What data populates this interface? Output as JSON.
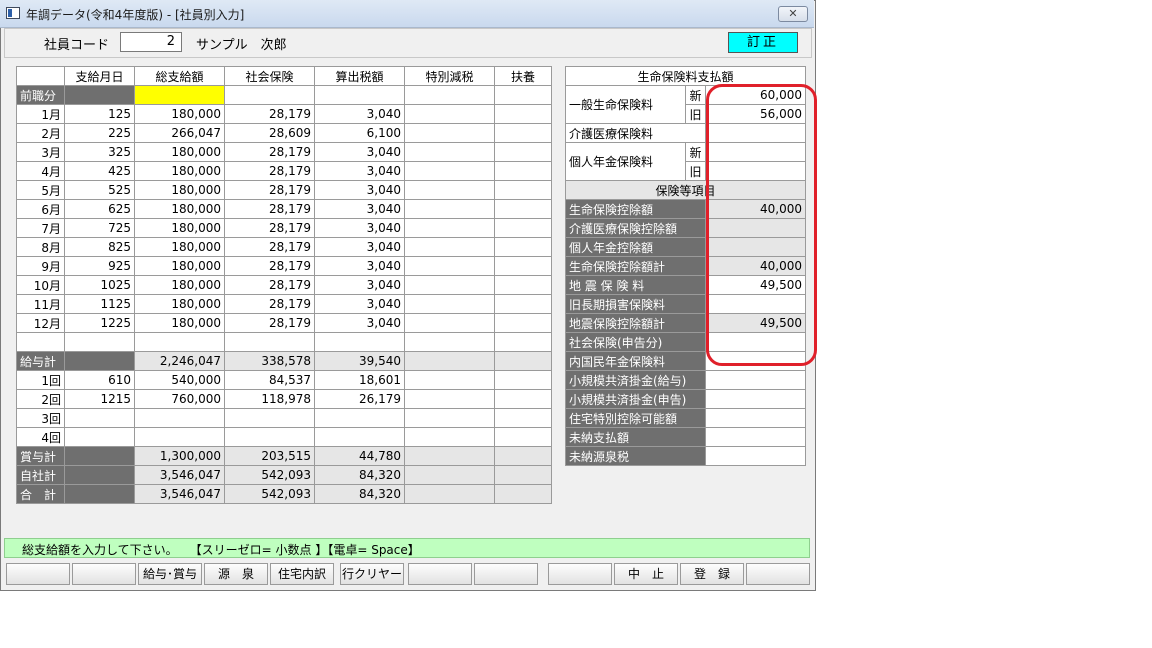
{
  "window": {
    "title": "年調データ(令和4年度版) - [社員別入力]",
    "close_icon": "close-icon"
  },
  "header": {
    "emp_code_label": "社員コード",
    "emp_code": "2",
    "emp_name": "サンプル　次郎",
    "mode": "訂正"
  },
  "main": {
    "columns": [
      "",
      "支給月日",
      "総支給額",
      "社会保険",
      "算出税額",
      "特別減税",
      "扶養"
    ],
    "prev_label": "前職分",
    "months": [
      {
        "label": "1月",
        "date": "125",
        "total": "180,000",
        "ins": "28,179",
        "tax": "3,040"
      },
      {
        "label": "2月",
        "date": "225",
        "total": "266,047",
        "ins": "28,609",
        "tax": "6,100"
      },
      {
        "label": "3月",
        "date": "325",
        "total": "180,000",
        "ins": "28,179",
        "tax": "3,040"
      },
      {
        "label": "4月",
        "date": "425",
        "total": "180,000",
        "ins": "28,179",
        "tax": "3,040"
      },
      {
        "label": "5月",
        "date": "525",
        "total": "180,000",
        "ins": "28,179",
        "tax": "3,040"
      },
      {
        "label": "6月",
        "date": "625",
        "total": "180,000",
        "ins": "28,179",
        "tax": "3,040"
      },
      {
        "label": "7月",
        "date": "725",
        "total": "180,000",
        "ins": "28,179",
        "tax": "3,040"
      },
      {
        "label": "8月",
        "date": "825",
        "total": "180,000",
        "ins": "28,179",
        "tax": "3,040"
      },
      {
        "label": "9月",
        "date": "925",
        "total": "180,000",
        "ins": "28,179",
        "tax": "3,040"
      },
      {
        "label": "10月",
        "date": "1025",
        "total": "180,000",
        "ins": "28,179",
        "tax": "3,040"
      },
      {
        "label": "11月",
        "date": "1125",
        "total": "180,000",
        "ins": "28,179",
        "tax": "3,040"
      },
      {
        "label": "12月",
        "date": "1225",
        "total": "180,000",
        "ins": "28,179",
        "tax": "3,040"
      }
    ],
    "salary_total": {
      "label": "給与計",
      "total": "2,246,047",
      "ins": "338,578",
      "tax": "39,540"
    },
    "bonuses": [
      {
        "label": "1回",
        "date": "610",
        "total": "540,000",
        "ins": "84,537",
        "tax": "18,601"
      },
      {
        "label": "2回",
        "date": "1215",
        "total": "760,000",
        "ins": "118,978",
        "tax": "26,179"
      },
      {
        "label": "3回",
        "date": "",
        "total": "",
        "ins": "",
        "tax": ""
      },
      {
        "label": "4回",
        "date": "",
        "total": "",
        "ins": "",
        "tax": ""
      }
    ],
    "bonus_total": {
      "label": "賞与計",
      "total": "1,300,000",
      "ins": "203,515",
      "tax": "44,780"
    },
    "company_total": {
      "label": "自社計",
      "total": "3,546,047",
      "ins": "542,093",
      "tax": "84,320"
    },
    "grand_total": {
      "label": "合　計",
      "total": "3,546,047",
      "ins": "542,093",
      "tax": "84,320"
    }
  },
  "right": {
    "title": "生命保険料支払額",
    "general_label": "一般生命保険料",
    "new_label": "新",
    "old_label": "旧",
    "general_new": "60,000",
    "general_old": "56,000",
    "care_label": "介護医療保険料",
    "pension_label": "個人年金保険料",
    "section2": "保険等項目",
    "items": [
      {
        "label": "生命保険控除額",
        "value": "40,000"
      },
      {
        "label": "介護医療保険控除額",
        "value": ""
      },
      {
        "label": "個人年金控除額",
        "value": ""
      },
      {
        "label": "生命保険控除額計",
        "value": "40,000"
      },
      {
        "label": "地 震 保 険 料",
        "value": "49,500"
      },
      {
        "label": "旧長期損害保険料",
        "value": ""
      },
      {
        "label": "地震保険控除額計",
        "value": "49,500"
      },
      {
        "label": "社会保険(申告分)",
        "value": ""
      },
      {
        "label": "内国民年金保険料",
        "value": ""
      },
      {
        "label": "小規模共済掛金(給与)",
        "value": ""
      },
      {
        "label": "小規模共済掛金(申告)",
        "value": ""
      },
      {
        "label": "住宅特別控除可能額",
        "value": ""
      },
      {
        "label": "未納支払額",
        "value": ""
      },
      {
        "label": "未納源泉税",
        "value": ""
      }
    ]
  },
  "status": "総支給額を入力して下さい。　　【スリーゼロ= 小数点 】【電卓= Space】",
  "fkeys": [
    "",
    "",
    "給与･賞与",
    "源　泉",
    "住宅内訳",
    "行クリヤー",
    "",
    "",
    "",
    "中　止",
    "登　録",
    ""
  ]
}
